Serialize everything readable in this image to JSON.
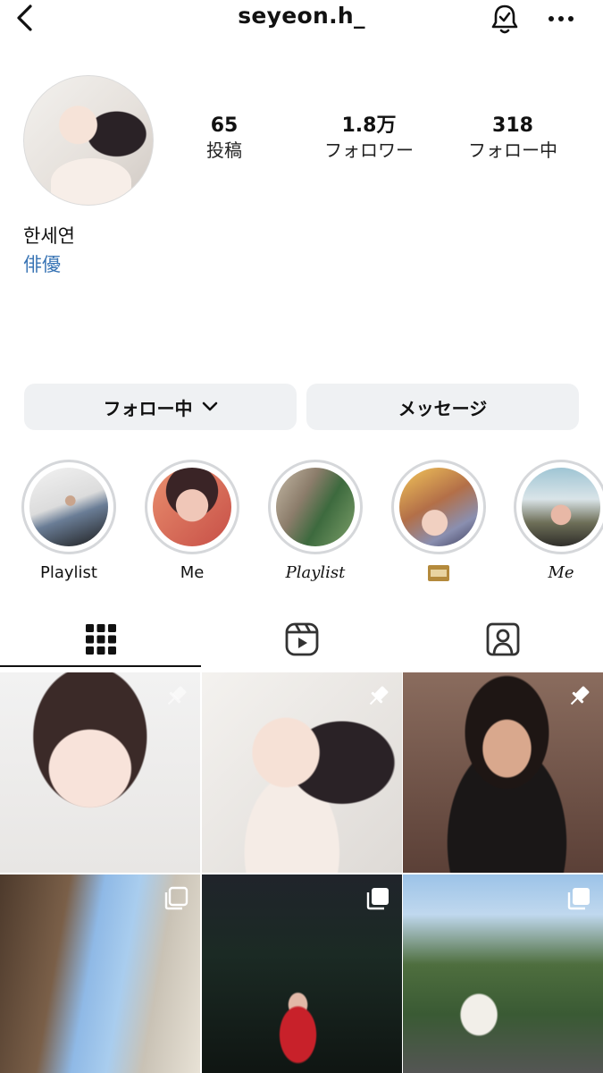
{
  "header": {
    "username": "seyeon.h_",
    "icons": [
      "chevron-left-icon",
      "bell-check-icon",
      "more-horizontal-icon"
    ]
  },
  "profile": {
    "display_name": "한세연",
    "category": "俳優",
    "category_color": "#3a75b5"
  },
  "stats": {
    "posts": {
      "value": "65",
      "label": "投稿"
    },
    "followers": {
      "value": "1.8万",
      "label": "フォロワー"
    },
    "following": {
      "value": "318",
      "label": "フォロー中"
    }
  },
  "actions": {
    "following_label": "フォロー中",
    "message_label": "メッセージ"
  },
  "highlights": [
    {
      "label": "Playlist"
    },
    {
      "label": "Me"
    },
    {
      "label": "Playlist"
    },
    {
      "label": "",
      "icon": "film-icon"
    },
    {
      "label": "Me"
    }
  ],
  "tabs": [
    {
      "name": "posts-grid",
      "icon": "grid-icon",
      "active": true
    },
    {
      "name": "reels",
      "icon": "reels-icon",
      "active": false
    },
    {
      "name": "tagged",
      "icon": "tagged-person-icon",
      "active": false
    }
  ],
  "posts": [
    {
      "overlay_icon": "pin-icon",
      "pinned": true
    },
    {
      "overlay_icon": "pin-icon",
      "pinned": true
    },
    {
      "overlay_icon": "pin-icon",
      "pinned": true
    },
    {
      "overlay_icon": "carousel-icon",
      "pinned": false
    },
    {
      "overlay_icon": "carousel-icon",
      "pinned": false
    },
    {
      "overlay_icon": "carousel-icon",
      "pinned": false
    }
  ]
}
